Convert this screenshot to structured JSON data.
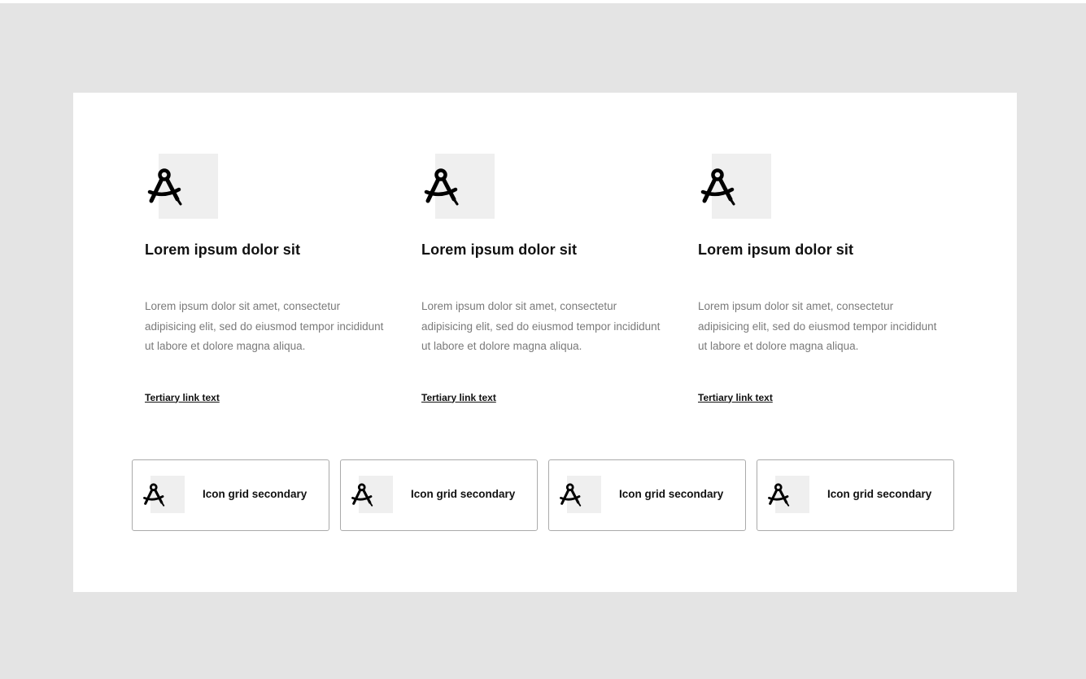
{
  "features": [
    {
      "icon": "drafting-compass-icon",
      "title": "Lorem ipsum dolor sit",
      "body": "Lorem ipsum dolor sit amet, consectetur adipisicing elit, sed do eiusmod tempor incididunt ut labore et dolore magna aliqua.",
      "link": "Tertiary link text"
    },
    {
      "icon": "drafting-compass-icon",
      "title": "Lorem ipsum dolor sit",
      "body": "Lorem ipsum dolor sit amet, consectetur adipisicing elit, sed do eiusmod tempor incididunt ut labore et dolore magna aliqua.",
      "link": "Tertiary link text"
    },
    {
      "icon": "drafting-compass-icon",
      "title": "Lorem ipsum dolor sit",
      "body": "Lorem ipsum dolor sit amet, consectetur adipisicing elit, sed do eiusmod tempor incididunt ut labore et dolore magna aliqua.",
      "link": "Tertiary link text"
    }
  ],
  "secondary": [
    {
      "icon": "drafting-compass-icon",
      "label": "Icon grid secondary"
    },
    {
      "icon": "drafting-compass-icon",
      "label": "Icon grid secondary"
    },
    {
      "icon": "drafting-compass-icon",
      "label": "Icon grid secondary"
    },
    {
      "icon": "drafting-compass-icon",
      "label": "Icon grid secondary"
    }
  ],
  "colors": {
    "page_background": "#e4e4e4",
    "panel_background": "#ffffff",
    "icon_placeholder": "#efefef",
    "body_text": "#7a7a7a",
    "card_border": "#aaaaaa"
  }
}
